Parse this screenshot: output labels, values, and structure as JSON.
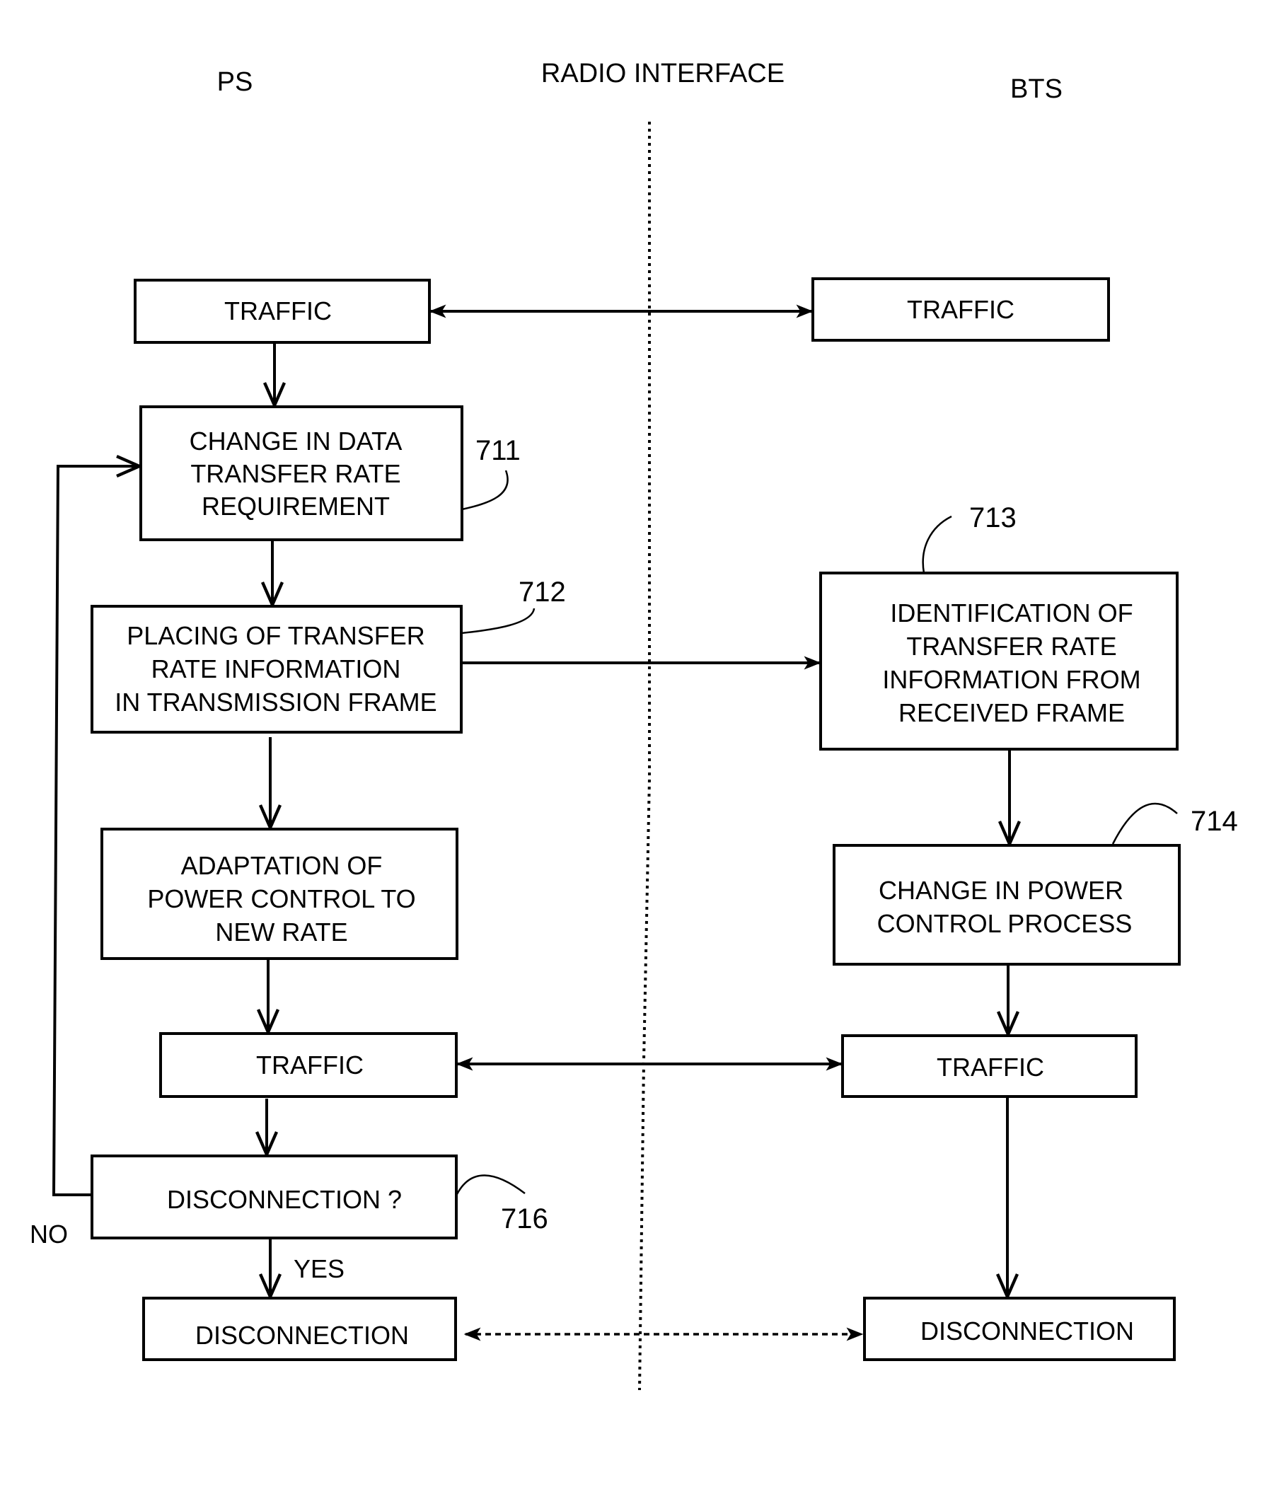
{
  "headers": {
    "left": "PS",
    "center": "RADIO INTERFACE",
    "right": "BTS"
  },
  "ps_column": {
    "traffic_1": "TRAFFIC",
    "change_rate": [
      "CHANGE IN DATA",
      "TRANSFER RATE",
      "REQUIREMENT"
    ],
    "placing": [
      "PLACING OF TRANSFER",
      "RATE INFORMATION",
      "IN TRANSMISSION FRAME"
    ],
    "adaptation": [
      "ADAPTATION OF",
      "POWER CONTROL TO",
      "NEW RATE"
    ],
    "traffic_2": "TRAFFIC",
    "decision": "DISCONNECTION ?",
    "disconnection": "DISCONNECTION"
  },
  "bts_column": {
    "traffic_1": "TRAFFIC",
    "identification": [
      "IDENTIFICATION OF",
      "TRANSFER RATE",
      "INFORMATION FROM",
      "RECEIVED FRAME"
    ],
    "change_power": [
      "CHANGE IN POWER",
      "CONTROL PROCESS"
    ],
    "traffic_2": "TRAFFIC",
    "disconnection": "DISCONNECTION"
  },
  "branch_labels": {
    "no": "NO",
    "yes": "YES"
  },
  "reference_numerals": {
    "r711": "711",
    "r712": "712",
    "r713": "713",
    "r714": "714",
    "r716": "716"
  }
}
